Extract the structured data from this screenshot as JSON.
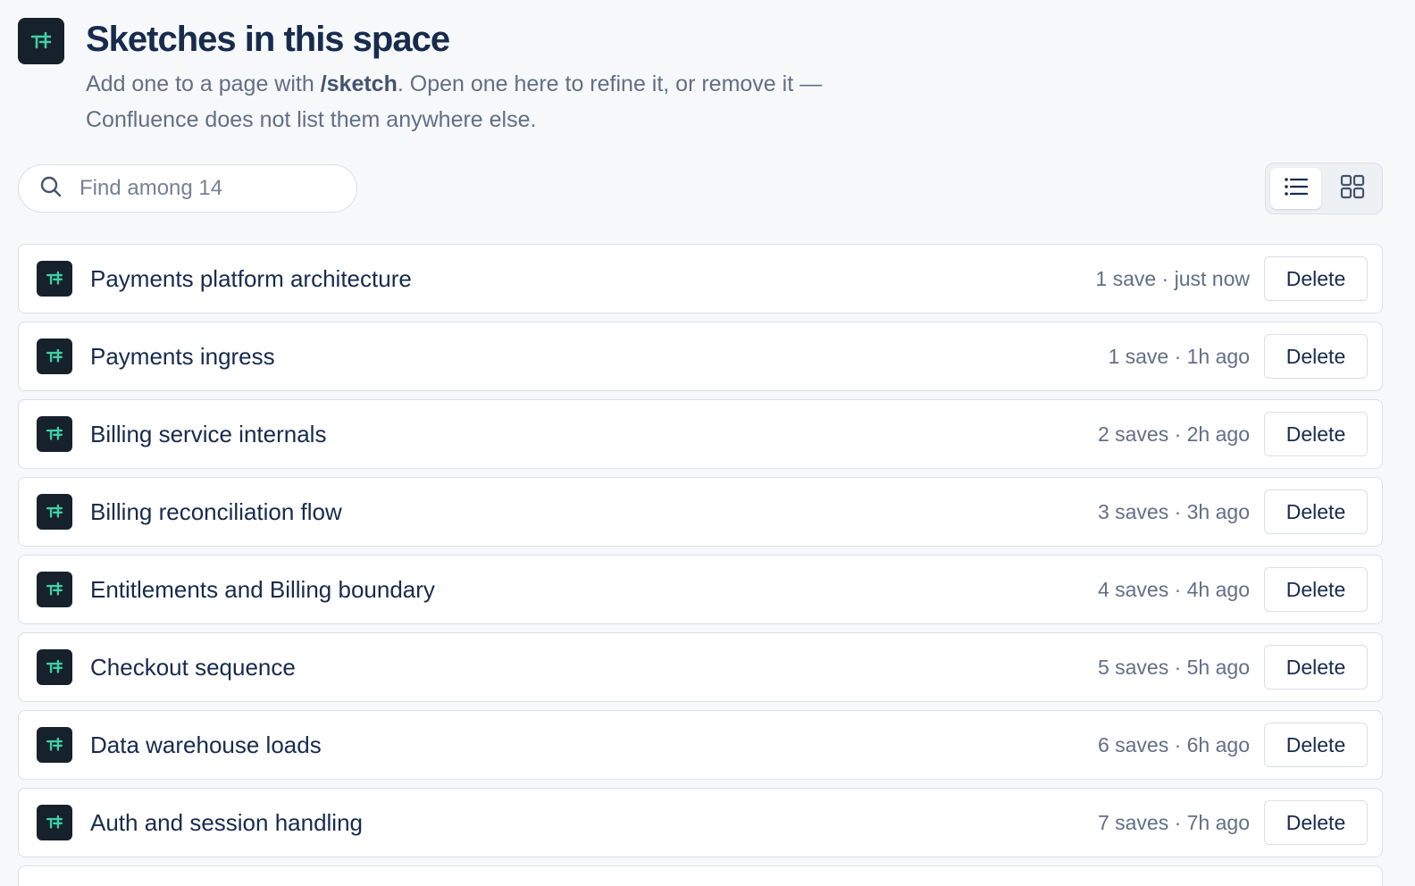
{
  "header": {
    "title": "Sketches in this space",
    "subtitle_before": "Add one to a page with ",
    "subtitle_command": "/sketch",
    "subtitle_after": ". Open one here to refine it, or remove it — Confluence does not list them anywhere else."
  },
  "search": {
    "placeholder": "Find among 14",
    "value": ""
  },
  "view_toggle": {
    "selected": "list",
    "options": [
      "list",
      "grid"
    ]
  },
  "colors": {
    "icon_bg": "#16212b",
    "icon_accent": "#3fd0a5",
    "border": "#dcdfe4",
    "background": "#f6f8fa"
  },
  "sketches": [
    {
      "title": "Payments platform architecture",
      "meta": "1 save · just now",
      "action": "Delete"
    },
    {
      "title": "Payments ingress",
      "meta": "1 save · 1h ago",
      "action": "Delete"
    },
    {
      "title": "Billing service internals",
      "meta": "2 saves · 2h ago",
      "action": "Delete"
    },
    {
      "title": "Billing reconciliation flow",
      "meta": "3 saves · 3h ago",
      "action": "Delete"
    },
    {
      "title": "Entitlements and Billing boundary",
      "meta": "4 saves · 4h ago",
      "action": "Delete"
    },
    {
      "title": "Checkout sequence",
      "meta": "5 saves · 5h ago",
      "action": "Delete"
    },
    {
      "title": "Data warehouse loads",
      "meta": "6 saves · 6h ago",
      "action": "Delete"
    },
    {
      "title": "Auth and session handling",
      "meta": "7 saves · 7h ago",
      "action": "Delete"
    }
  ]
}
